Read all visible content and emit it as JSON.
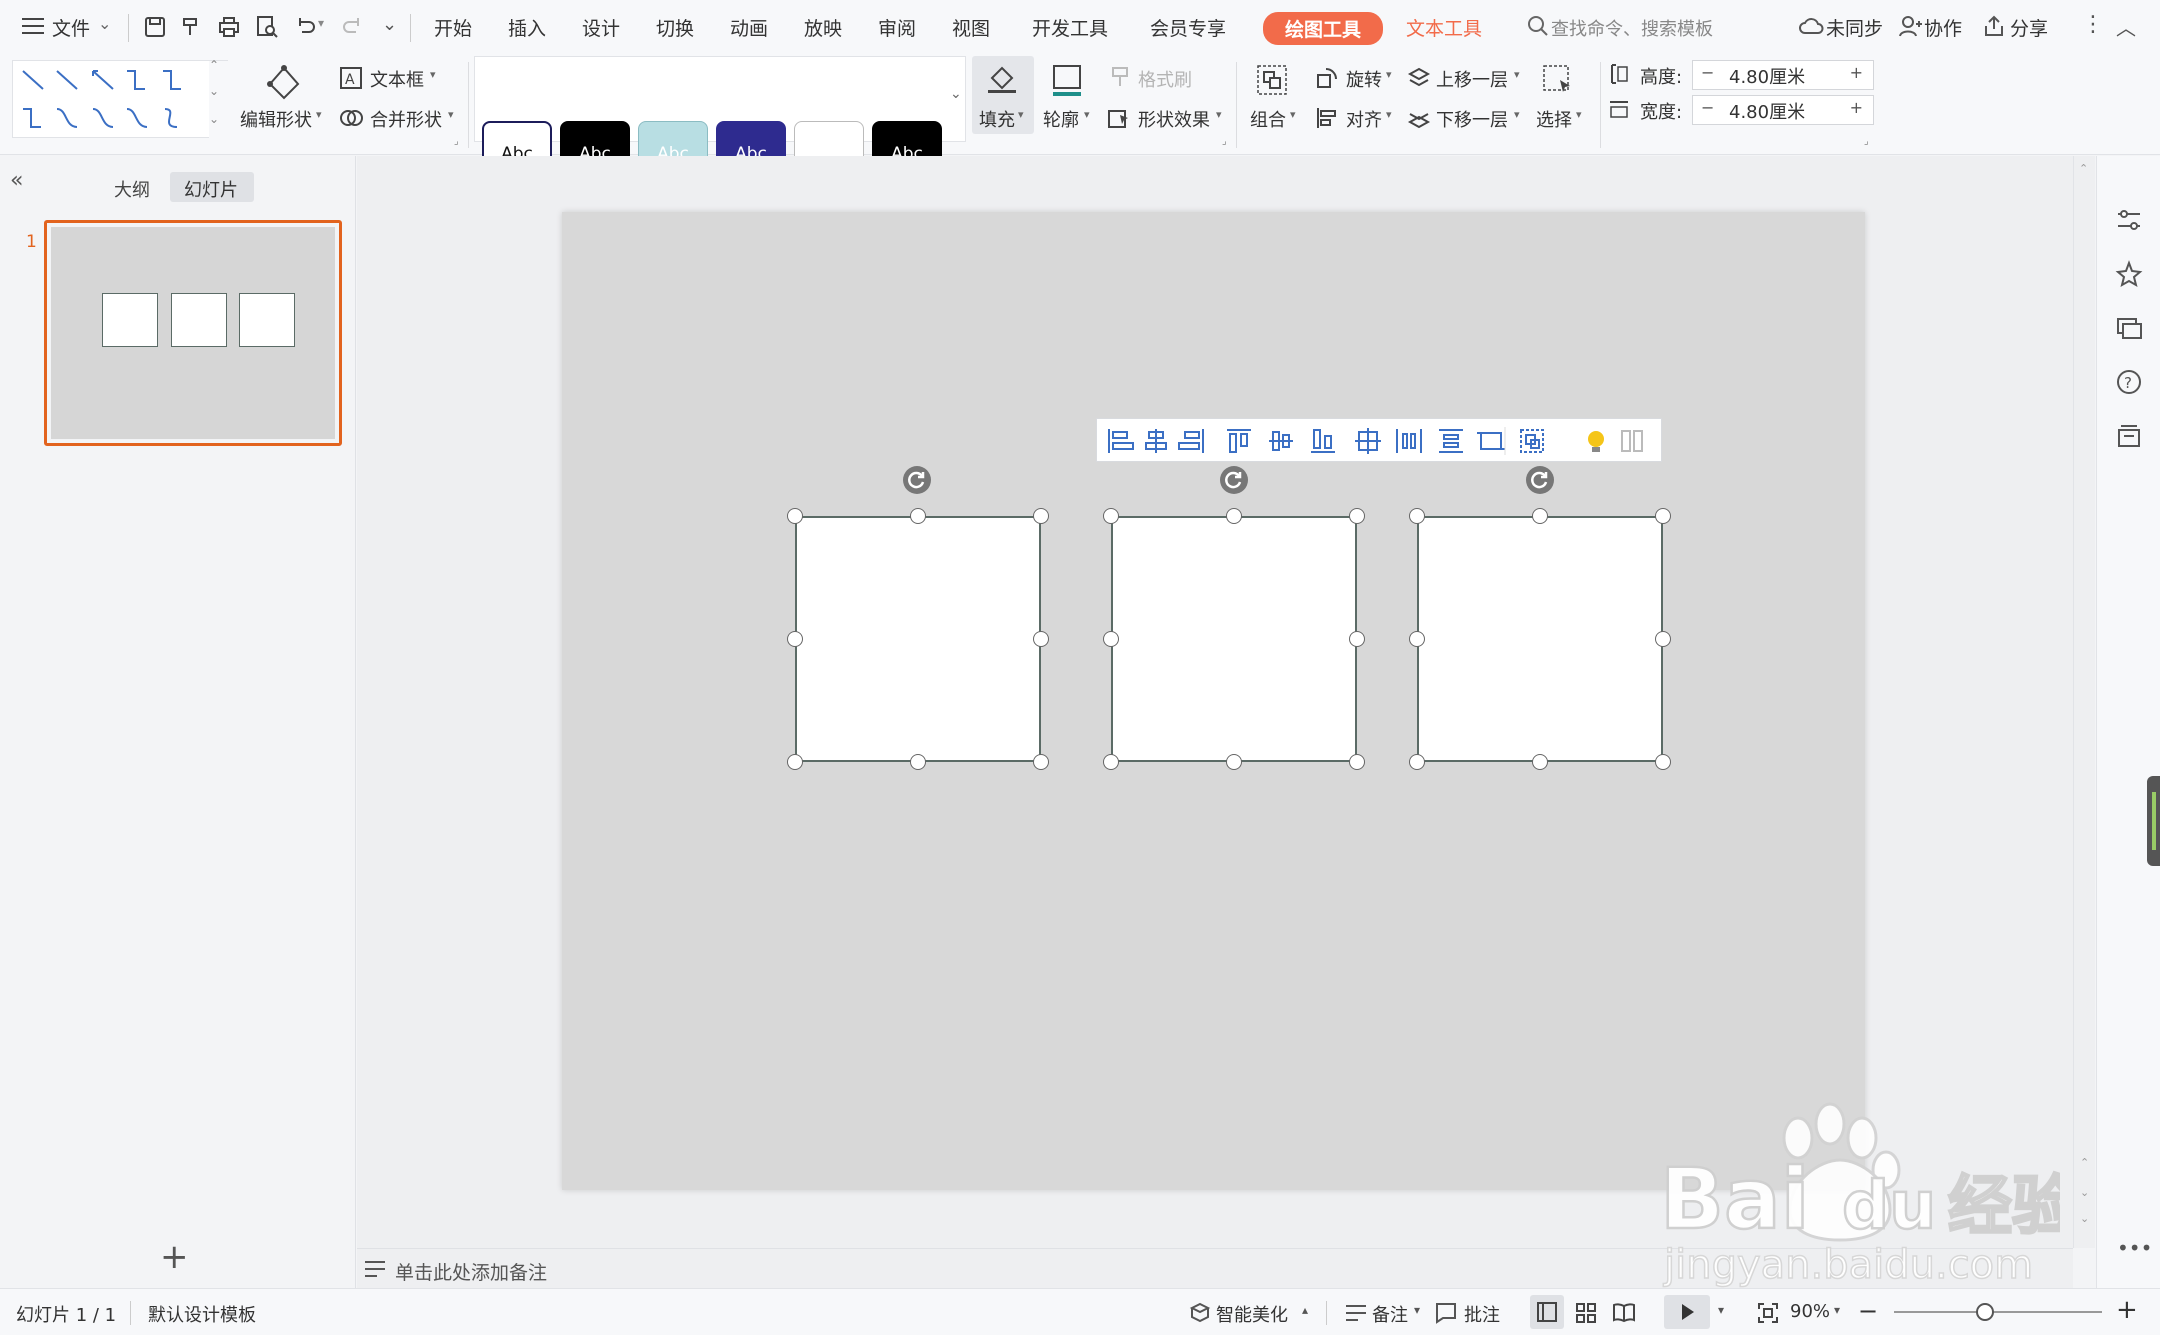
{
  "menubar": {
    "file_label": "文件",
    "tabs": [
      "开始",
      "插入",
      "设计",
      "切换",
      "动画",
      "放映",
      "审阅",
      "视图",
      "开发工具",
      "会员专享"
    ],
    "context_tabs": [
      "绘图工具",
      "文本工具"
    ],
    "search_placeholder": "查找命令、搜索模板",
    "right_actions": [
      "未同步",
      "协作",
      "分享"
    ]
  },
  "ribbon": {
    "edit_shape": "编辑形状",
    "text_box": "文本框",
    "merge_shape": "合并形状",
    "style_samples": [
      "Abc",
      "Abc",
      "Abc",
      "Abc",
      "",
      "Abc"
    ],
    "fill": "填充",
    "outline": "轮廓",
    "format_painter": "格式刷",
    "shape_effects": "形状效果",
    "group": "组合",
    "rotate": "旋转",
    "align": "对齐",
    "bring_forward": "上移一层",
    "send_backward": "下移一层",
    "select": "选择",
    "height_label": "高度:",
    "height_value": "4.80厘米",
    "width_label": "宽度:",
    "width_value": "4.80厘米",
    "minus": "−",
    "plus": "+"
  },
  "left_panel": {
    "tabs": [
      "大纲",
      "幻灯片"
    ],
    "active_tab": "幻灯片",
    "slide_number": "1"
  },
  "notes": {
    "placeholder": "单击此处添加备注"
  },
  "statusbar": {
    "slide_indicator": "幻灯片 1 / 1",
    "template": "默认设计模板",
    "smart_beautify": "智能美化",
    "notes": "备注",
    "comments": "批注",
    "zoom": "90%"
  },
  "watermark": {
    "brand": "Bai经验",
    "url": "jingyan.baidu.com"
  },
  "colors": {
    "accent": "#f26b4a",
    "slide_bg": "#d8d8d8",
    "shape_border": "#5b6b66"
  }
}
